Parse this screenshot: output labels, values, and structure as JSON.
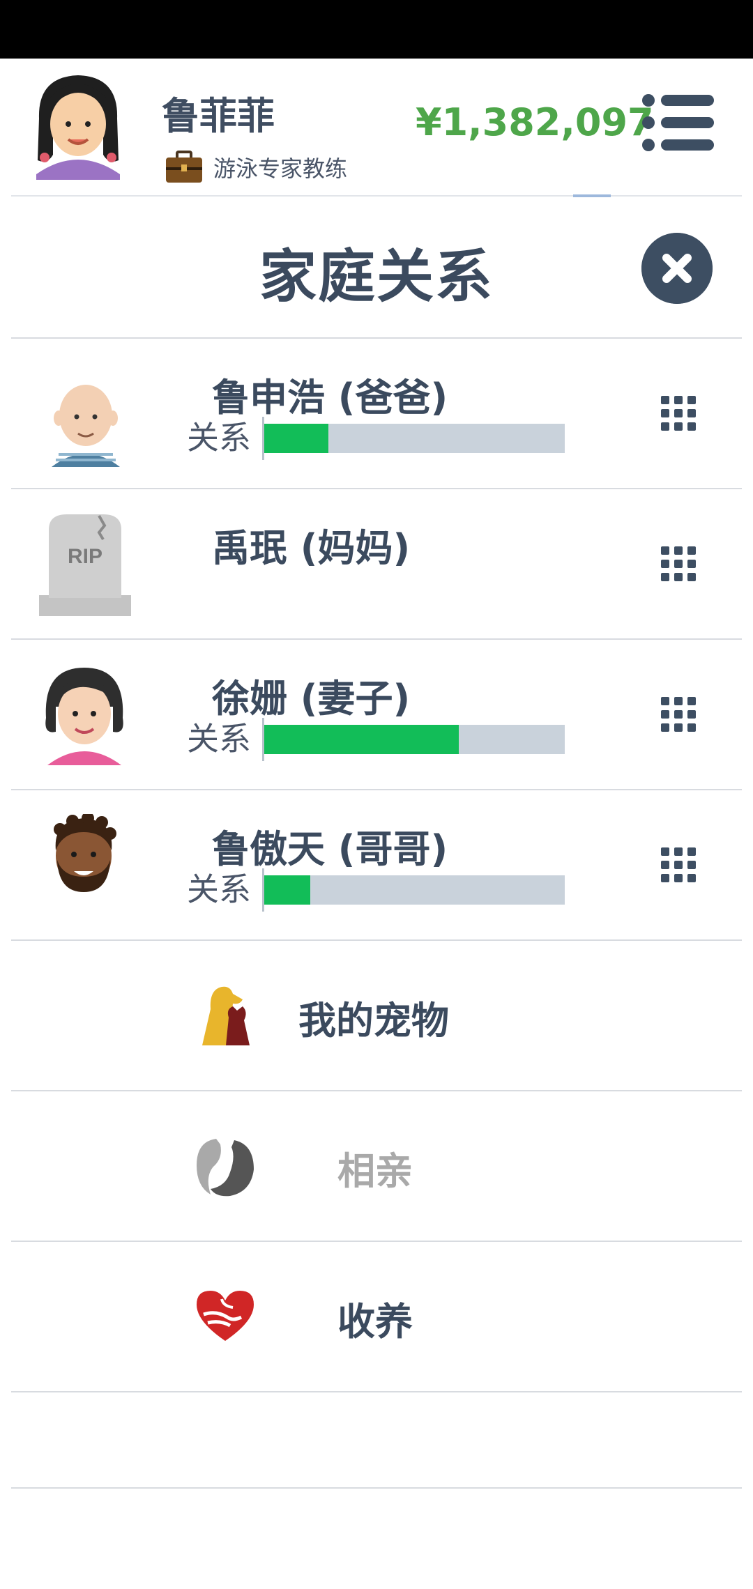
{
  "player": {
    "name": "鲁菲菲",
    "job": "游泳专家教练",
    "money": "¥1,382,097"
  },
  "page": {
    "title": "家庭关系"
  },
  "relationship_label": "关系",
  "members": [
    {
      "name": "鲁申浩 (爸爸)",
      "relationship": 0.22,
      "alive": true
    },
    {
      "name": "禹珉 (妈妈)",
      "alive": false,
      "tombstone_text": "RIP"
    },
    {
      "name": "徐姗 (妻子)",
      "relationship": 0.65,
      "alive": true
    },
    {
      "name": "鲁傲天 (哥哥)",
      "relationship": 0.16,
      "alive": true
    }
  ],
  "menu": {
    "pets": "我的宠物",
    "dating": "相亲",
    "adopt": "收养"
  },
  "colors": {
    "money": "#4ea64a",
    "bar_fill": "#12bd58",
    "bar_track": "#c9d2db",
    "dark": "#3d4e62"
  },
  "icons": {
    "menu": "hamburger-icon",
    "close": "close-icon",
    "options": "grid-dots-icon",
    "job": "briefcase-icon",
    "pets": "dog-cat-icon",
    "dating": "couple-icon",
    "adopt": "heart-hands-icon"
  }
}
